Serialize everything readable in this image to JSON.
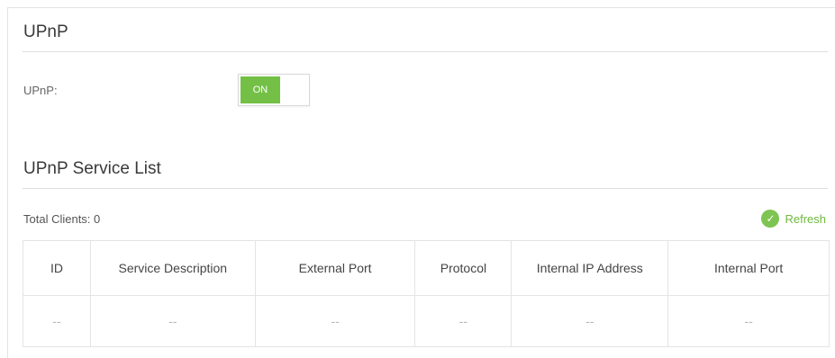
{
  "upnp_section": {
    "title": "UPnP",
    "field_label": "UPnP:",
    "toggle_label": "ON"
  },
  "service_section": {
    "title": "UPnP Service List",
    "total_clients": "Total Clients: 0",
    "refresh_label": "Refresh"
  },
  "table": {
    "headers": [
      "ID",
      "Service Description",
      "External Port",
      "Protocol",
      "Internal IP Address",
      "Internal Port"
    ],
    "rows": [
      [
        "--",
        "--",
        "--",
        "--",
        "--",
        "--"
      ]
    ]
  },
  "colors": {
    "toggle_on": "#74c046",
    "refresh": "#6fb83f"
  },
  "icons": {
    "refresh": "refresh-icon"
  }
}
